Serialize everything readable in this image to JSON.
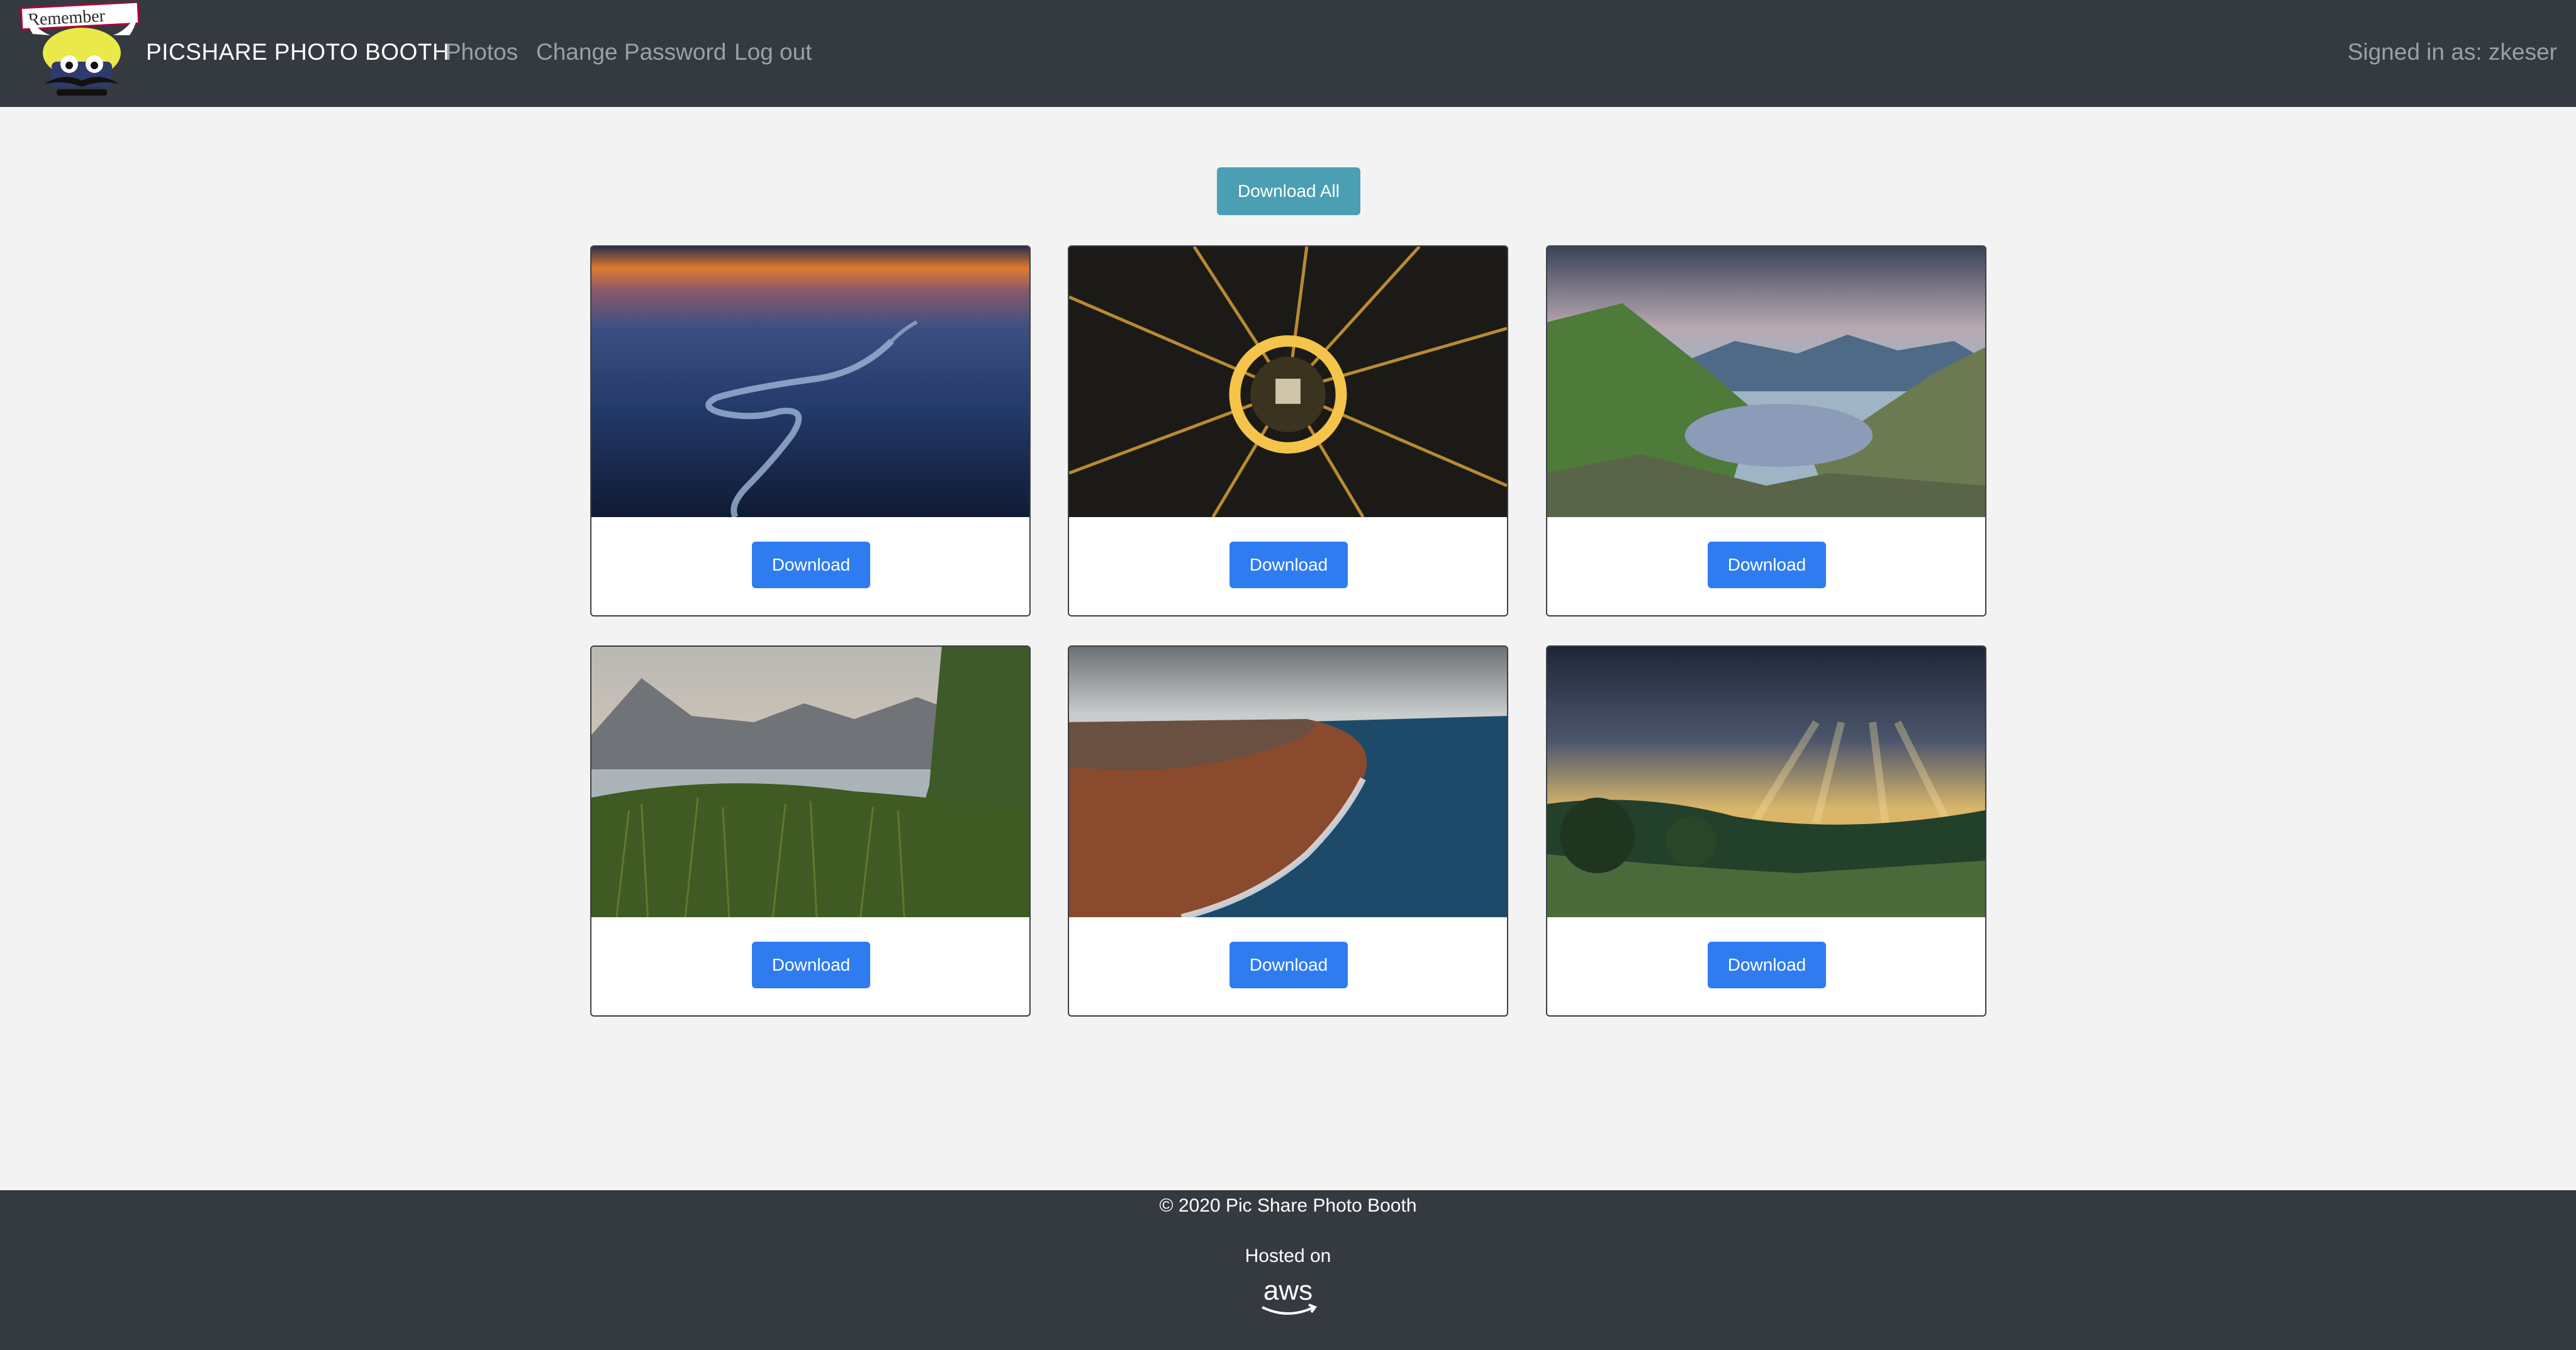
{
  "navbar": {
    "logo_text": "Remember",
    "brand": "PICSHARE PHOTO BOOTH",
    "links": [
      "Photos",
      "Change Password",
      "Log out"
    ],
    "signed_in": "Signed in as: zkeser"
  },
  "main": {
    "download_all_label": "Download All",
    "cards": [
      {
        "image": "aerial-city-river-sunset",
        "download_label": "Download"
      },
      {
        "image": "arc-de-triomphe-night-aerial",
        "download_label": "Download"
      },
      {
        "image": "mountain-lake-cloudy",
        "download_label": "Download"
      },
      {
        "image": "lake-reeds-mountains",
        "download_label": "Download"
      },
      {
        "image": "coastline-aerial-waves",
        "download_label": "Download"
      },
      {
        "image": "sunrays-over-green-hills",
        "download_label": "Download"
      }
    ]
  },
  "footer": {
    "copyright": "© 2020 Pic Share Photo Booth",
    "hosted_on": "Hosted on",
    "host_logo_text": "aws"
  },
  "colors": {
    "navbar": "#343a40",
    "background": "#f3f3f3",
    "download_button": "#2f7cf0",
    "download_all_button": "#4a9fb2"
  }
}
